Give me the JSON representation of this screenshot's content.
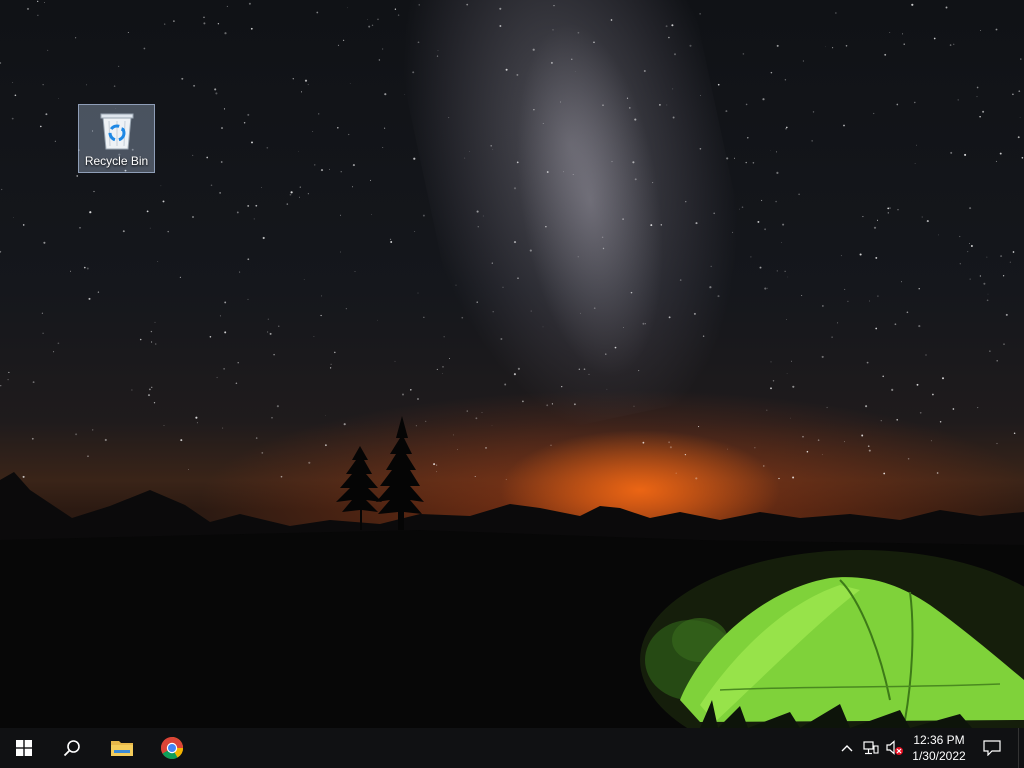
{
  "desktop": {
    "wallpaper": "night-sky-tent-wallpaper",
    "icons": [
      {
        "label": "Recycle Bin",
        "icon": "recycle-bin-icon"
      }
    ]
  },
  "taskbar": {
    "start": {
      "icon": "windows-logo-icon"
    },
    "search": {
      "icon": "search-icon"
    },
    "pinned": [
      {
        "icon": "file-explorer-icon"
      },
      {
        "icon": "chrome-icon"
      }
    ],
    "tray": {
      "chevron": {
        "icon": "chevron-up-icon"
      },
      "network": {
        "icon": "network-icon"
      },
      "volume": {
        "icon": "volume-muted-icon"
      },
      "clock": {
        "time": "12:36 PM",
        "date": "1/30/2022"
      },
      "notifications": {
        "icon": "notification-icon"
      }
    },
    "colors": {
      "background": "#101113",
      "text": "#ffffff"
    }
  }
}
